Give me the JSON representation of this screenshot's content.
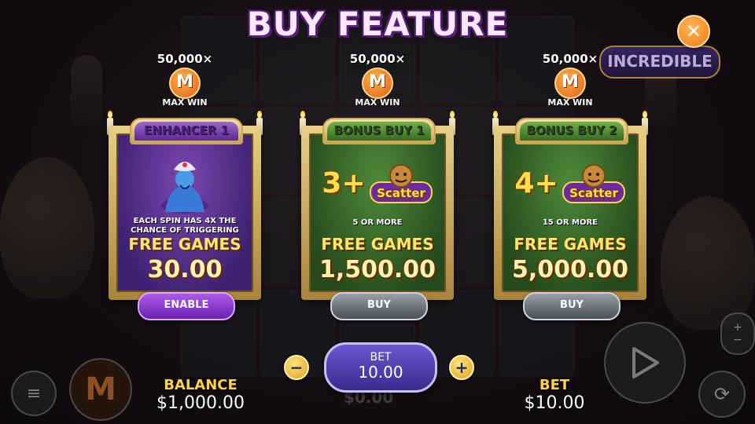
{
  "title": "BUY FEATURE",
  "badge_incredible": "INCREDIBLE",
  "cards": [
    {
      "theme": "purple",
      "max_multiplier": "50,000×",
      "max_badge_letter": "M",
      "tm": "TM",
      "max_label": "MAX WIN",
      "header": "ENHANCER 1",
      "description": "EACH SPIN HAS 4X THE CHANCE OF TRIGGERING",
      "free_games": "FREE GAMES",
      "price": "30.00",
      "button": "ENABLE"
    },
    {
      "theme": "green",
      "max_multiplier": "50,000×",
      "max_badge_letter": "M",
      "tm": "TM",
      "max_label": "MAX WIN",
      "header": "BONUS BUY 1",
      "scatter_count": "3+",
      "scatter_word": "Scatter",
      "description": "5 OR MORE",
      "free_games": "FREE GAMES",
      "price": "1,500.00",
      "button": "BUY"
    },
    {
      "theme": "green",
      "max_multiplier": "50,000×",
      "max_badge_letter": "M",
      "tm": "TM",
      "max_label": "MAX WIN",
      "header": "BONUS BUY 2",
      "scatter_count": "4+",
      "scatter_word": "Scatter",
      "description": "15 OR MORE",
      "free_games": "FREE GAMES",
      "price": "5,000.00",
      "button": "BUY"
    }
  ],
  "hud": {
    "balance_label": "BALANCE",
    "balance_value": "$1,000.00",
    "bet_label": "BET",
    "bet_value": "$10.00",
    "bet_pill_label": "BET",
    "bet_pill_value": "10.00",
    "ghost_win": "$0.00",
    "minus": "−",
    "plus": "+",
    "logo_letter": "M"
  },
  "icons": {
    "close": "close-icon",
    "menu": "menu-icon",
    "play": "play-icon",
    "autoplay": "autoplay-icon",
    "stake": "stake-icon"
  },
  "colors": {
    "title": "#fbe7ff",
    "title_outline": "#5a1a7a",
    "accent_gold": "#ffd24a",
    "enable_button": "#8a3ad0",
    "buy_button": "#6a7078",
    "close_button": "#f07a10"
  }
}
